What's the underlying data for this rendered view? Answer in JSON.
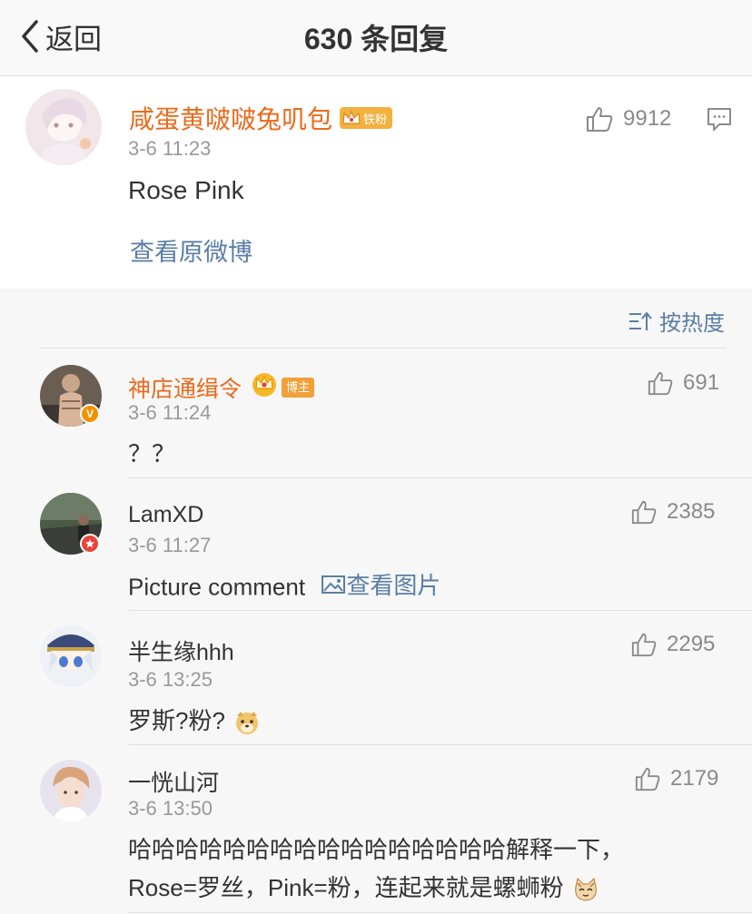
{
  "header": {
    "back_label": "返回",
    "title": "630 条回复"
  },
  "main_post": {
    "author": "咸蛋黄啵啵兔叽包",
    "fan_badge": "铁粉",
    "time": "3-6 11:23",
    "text": "Rose Pink",
    "likes": "9912",
    "view_original": "查看原微博"
  },
  "sort": {
    "label": "按热度"
  },
  "comments": [
    {
      "author": "神店通缉令",
      "badge": "博主",
      "time": "3-6 11:24",
      "text": "？？",
      "likes": "691"
    },
    {
      "author": "LamXD",
      "time": "3-6 11:27",
      "text": "Picture comment",
      "link": "查看图片",
      "likes": "2385"
    },
    {
      "author": "半生缘hhh",
      "time": "3-6 13:25",
      "text": "罗斯?粉?",
      "likes": "2295"
    },
    {
      "author": "一恍山河",
      "time": "3-6 13:50",
      "text_line1": "哈哈哈哈哈哈哈哈哈哈哈哈哈哈哈哈解释一下，",
      "text_line2": "Rose=罗丝，Pink=粉，连起来就是螺蛳粉",
      "likes": "2179"
    }
  ],
  "colors": {
    "accent_name": "#ea6a1b",
    "link": "#5a7ea6",
    "muted": "#999999"
  }
}
